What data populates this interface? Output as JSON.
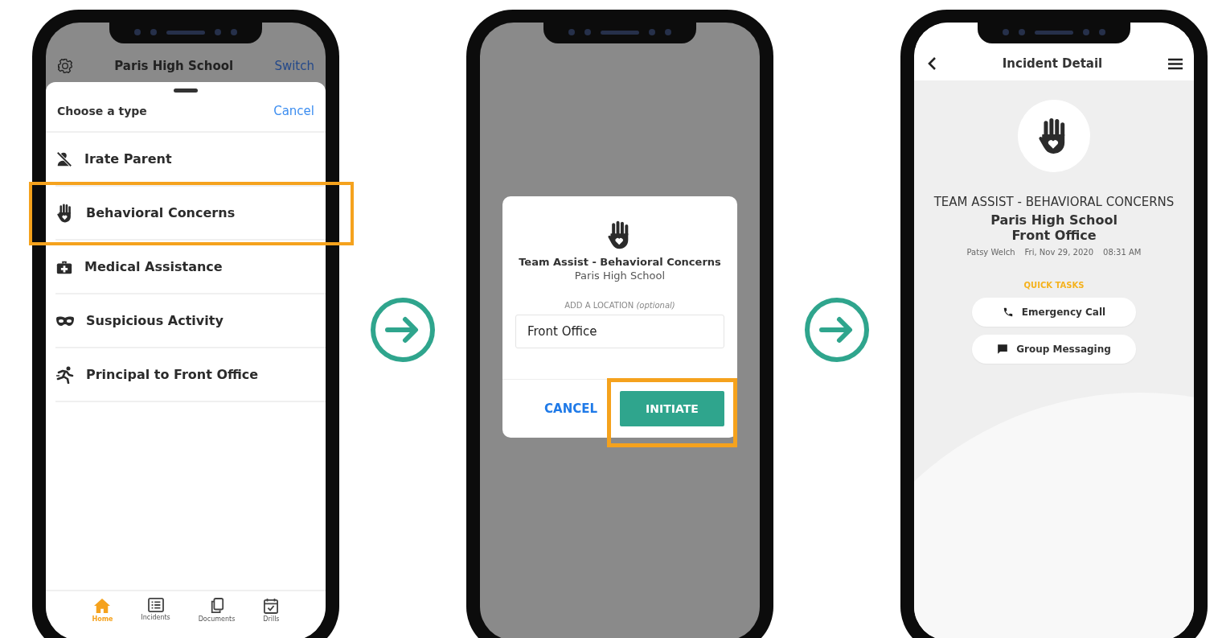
{
  "type_picker": {
    "header": {
      "title": "Paris High School",
      "action": "Switch"
    },
    "sheet": {
      "title": "Choose a type",
      "cancel": "Cancel"
    },
    "items": [
      {
        "label": "Irate Parent",
        "highlighted": false
      },
      {
        "label": "Behavioral Concerns",
        "highlighted": true
      },
      {
        "label": "Medical Assistance",
        "highlighted": false
      },
      {
        "label": "Suspicious Activity",
        "highlighted": false
      },
      {
        "label": "Principal to Front Office",
        "highlighted": false
      }
    ],
    "nav": [
      {
        "label": "Home",
        "selected": true
      },
      {
        "label": "Incidents",
        "selected": false
      },
      {
        "label": "Documents",
        "selected": false
      },
      {
        "label": "Drills",
        "selected": false
      }
    ]
  },
  "confirm_dialog": {
    "title": "Team Assist - Behavioral Concerns",
    "school": "Paris High School",
    "location_label": "ADD A LOCATION *(optional)*",
    "location_value": "Front Office",
    "cancel": "CANCEL",
    "initiate": "INITIATE",
    "initiate_highlighted": true
  },
  "incident_detail": {
    "title": "Incident Detail",
    "incident_type": "TEAM ASSIST - BEHAVIORAL CONCERNS",
    "school": "Paris High School",
    "location": "Front Office",
    "reporter": "Patsy Welch",
    "date": "Fri, Nov 29, 2020",
    "time": "08:31 AM",
    "section": "QUICK TASKS",
    "tasks": [
      "Emergency Call",
      "Group Messaging"
    ]
  }
}
